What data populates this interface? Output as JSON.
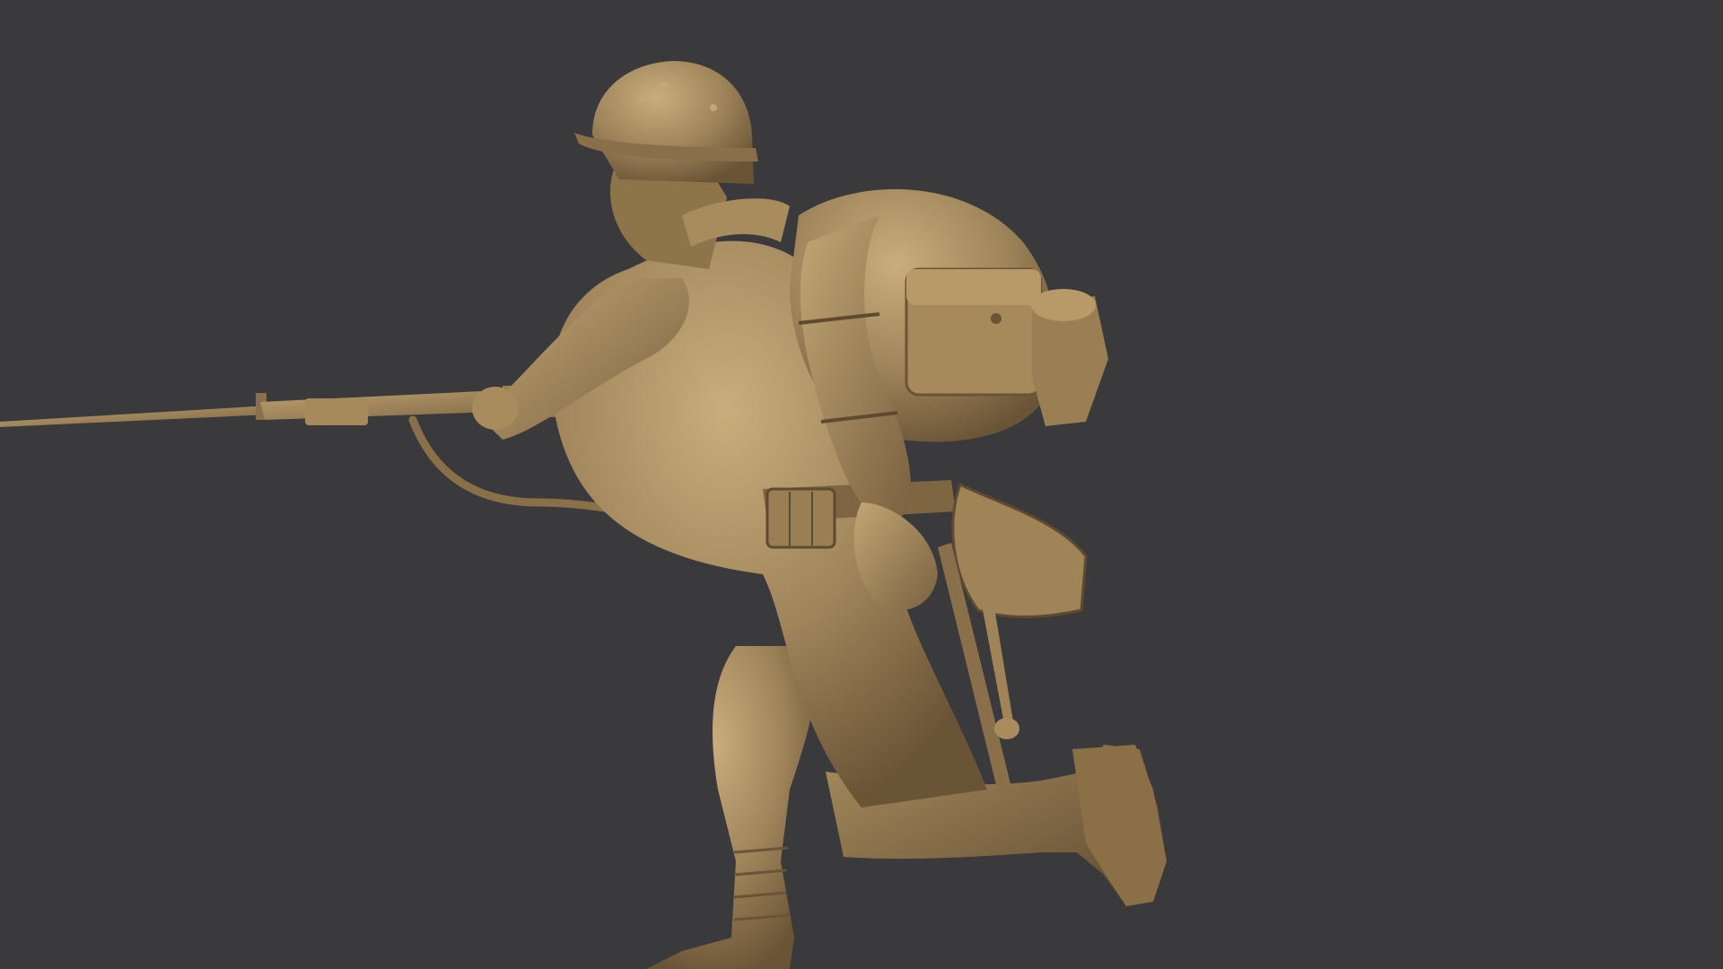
{
  "scene": {
    "background_color": "#3a3a3c",
    "subject": "sculpted-soldier-figure",
    "material_color": "#9c8258",
    "material_highlight": "#c4a878",
    "material_shadow": "#5e4a30"
  }
}
